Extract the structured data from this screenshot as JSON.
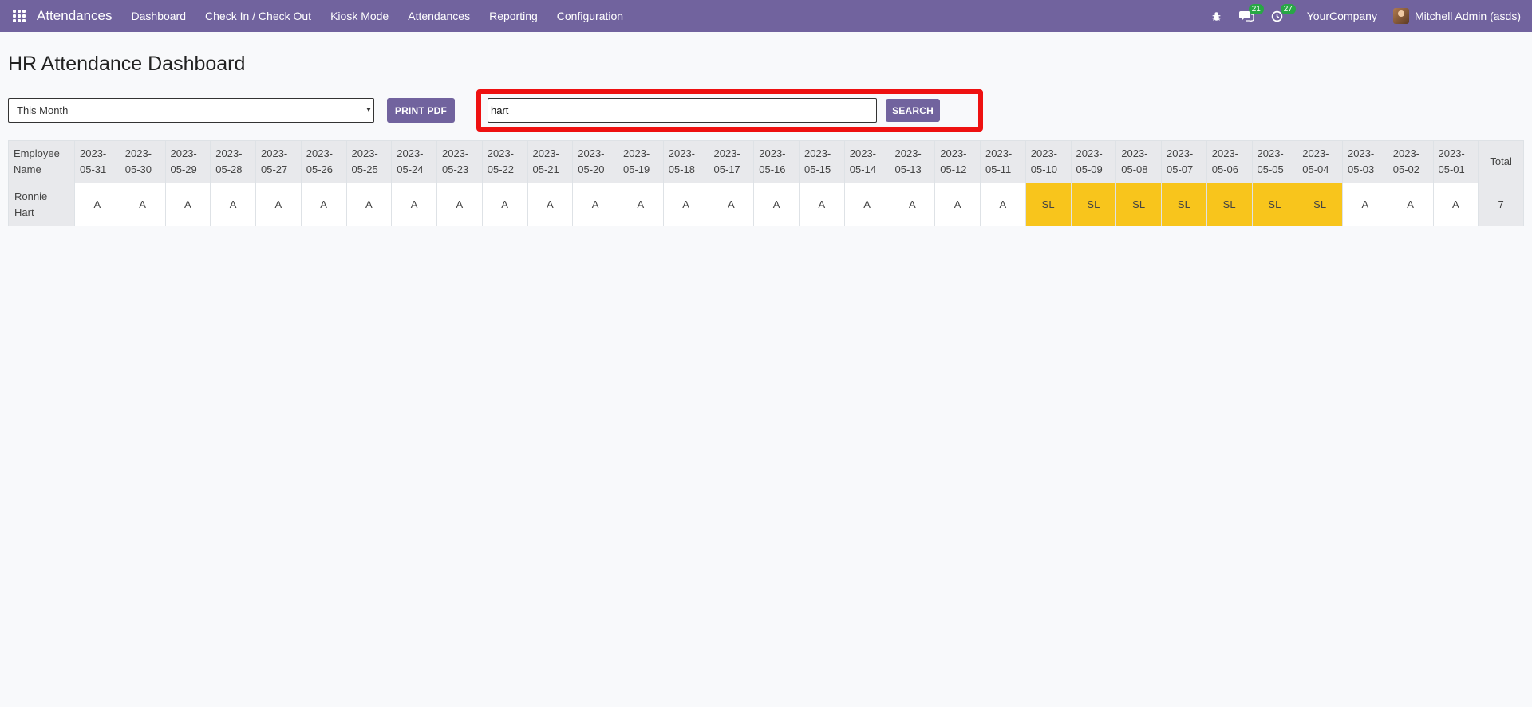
{
  "navbar": {
    "brand": "Attendances",
    "menu": [
      "Dashboard",
      "Check In / Check Out",
      "Kiosk Mode",
      "Attendances",
      "Reporting",
      "Configuration"
    ],
    "messages_count": "21",
    "activities_count": "27",
    "company": "YourCompany",
    "user": "Mitchell Admin (asds)",
    "color": "#71639e"
  },
  "page": {
    "title": "HR Attendance Dashboard",
    "period_selected": "This Month",
    "print_label": "PRINT PDF",
    "search_value": "hart",
    "search_label": "SEARCH"
  },
  "table": {
    "name_header": "Employee Name",
    "total_header": "Total",
    "dates": [
      "2023-05-31",
      "2023-05-30",
      "2023-05-29",
      "2023-05-28",
      "2023-05-27",
      "2023-05-26",
      "2023-05-25",
      "2023-05-24",
      "2023-05-23",
      "2023-05-22",
      "2023-05-21",
      "2023-05-20",
      "2023-05-19",
      "2023-05-18",
      "2023-05-17",
      "2023-05-16",
      "2023-05-15",
      "2023-05-14",
      "2023-05-13",
      "2023-05-12",
      "2023-05-11",
      "2023-05-10",
      "2023-05-09",
      "2023-05-08",
      "2023-05-07",
      "2023-05-06",
      "2023-05-05",
      "2023-05-04",
      "2023-05-03",
      "2023-05-02",
      "2023-05-01"
    ],
    "rows": [
      {
        "name": "Ronnie Hart",
        "values": [
          "A",
          "A",
          "A",
          "A",
          "A",
          "A",
          "A",
          "A",
          "A",
          "A",
          "A",
          "A",
          "A",
          "A",
          "A",
          "A",
          "A",
          "A",
          "A",
          "A",
          "A",
          "SL",
          "SL",
          "SL",
          "SL",
          "SL",
          "SL",
          "SL",
          "A",
          "A",
          "A"
        ],
        "total": "7"
      }
    ],
    "leave_color": "#f8c51c"
  }
}
